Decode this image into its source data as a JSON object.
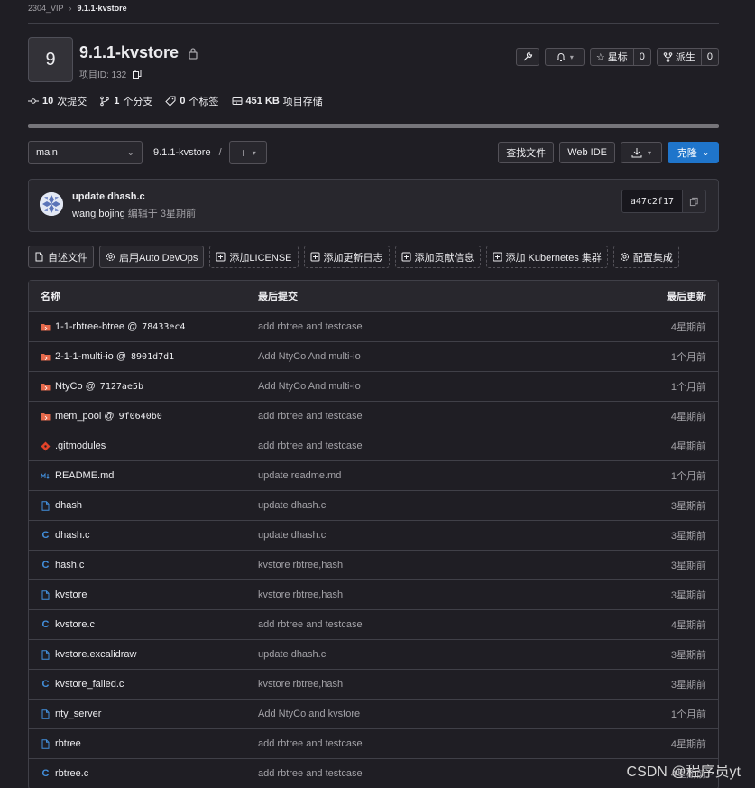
{
  "breadcrumb": {
    "parent": "2304_VIP",
    "current": "9.1.1-kvstore"
  },
  "project": {
    "avatar_letter": "9",
    "title": "9.1.1-kvstore",
    "id_label": "项目ID: 132"
  },
  "header_buttons": {
    "star_label": "星标",
    "star_count": "0",
    "fork_label": "派生",
    "fork_count": "0"
  },
  "stats": {
    "commits": "10",
    "commits_label": "次提交",
    "branches": "1",
    "branches_label": "个分支",
    "tags": "0",
    "tags_label": "个标签",
    "storage": "451 KB",
    "storage_label": "项目存储"
  },
  "toolbar": {
    "branch": "main",
    "path": "9.1.1-kvstore",
    "slash": "/",
    "find_file": "查找文件",
    "web_ide": "Web IDE",
    "clone": "克隆"
  },
  "last_commit": {
    "title": "update dhash.c",
    "author": "wang bojing",
    "edited": "编辑于 3星期前",
    "sha": "a47c2f17"
  },
  "actions": [
    {
      "label": "自述文件",
      "style": "solid",
      "icon": "file-icon"
    },
    {
      "label": "启用Auto DevOps",
      "style": "solid",
      "icon": "gear-icon"
    },
    {
      "label": "添加LICENSE",
      "style": "dashed",
      "icon": "plus-square-icon"
    },
    {
      "label": "添加更新日志",
      "style": "dashed",
      "icon": "plus-square-icon"
    },
    {
      "label": "添加贡献信息",
      "style": "dashed",
      "icon": "plus-square-icon"
    },
    {
      "label": "添加 Kubernetes 集群",
      "style": "dashed",
      "icon": "plus-square-icon"
    },
    {
      "label": "配置集成",
      "style": "dashed",
      "icon": "gear-icon"
    }
  ],
  "table": {
    "headers": {
      "name": "名称",
      "last_commit": "最后提交",
      "last_update": "最后更新"
    },
    "rows": [
      {
        "name": "1-1-rbtree-btree @",
        "ref": "78433ec4",
        "icon": "submodule-folder-icon",
        "msg": "add rbtree and testcase",
        "date": "4星期前"
      },
      {
        "name": "2-1-1-multi-io @",
        "ref": "8901d7d1",
        "icon": "submodule-folder-icon",
        "msg": "Add NtyCo And multi-io",
        "date": "1个月前"
      },
      {
        "name": "NtyCo @",
        "ref": "7127ae5b",
        "icon": "submodule-folder-icon",
        "msg": "Add NtyCo And multi-io",
        "date": "1个月前"
      },
      {
        "name": "mem_pool @",
        "ref": "9f0640b0",
        "icon": "submodule-folder-icon",
        "msg": "add rbtree and testcase",
        "date": "4星期前"
      },
      {
        "name": ".gitmodules",
        "ref": "",
        "icon": "git-icon",
        "msg": "add rbtree and testcase",
        "date": "4星期前"
      },
      {
        "name": "README.md",
        "ref": "",
        "icon": "markdown-icon",
        "msg": "update readme.md",
        "date": "1个月前"
      },
      {
        "name": "dhash",
        "ref": "",
        "icon": "file-icon",
        "msg": "update dhash.c",
        "date": "3星期前"
      },
      {
        "name": "dhash.c",
        "ref": "",
        "icon": "c-file-icon",
        "msg": "update dhash.c",
        "date": "3星期前"
      },
      {
        "name": "hash.c",
        "ref": "",
        "icon": "c-file-icon",
        "msg": "kvstore rbtree,hash",
        "date": "3星期前"
      },
      {
        "name": "kvstore",
        "ref": "",
        "icon": "file-icon",
        "msg": "kvstore rbtree,hash",
        "date": "3星期前"
      },
      {
        "name": "kvstore.c",
        "ref": "",
        "icon": "c-file-icon",
        "msg": "add rbtree and testcase",
        "date": "4星期前"
      },
      {
        "name": "kvstore.excalidraw",
        "ref": "",
        "icon": "file-icon",
        "msg": "update dhash.c",
        "date": "3星期前"
      },
      {
        "name": "kvstore_failed.c",
        "ref": "",
        "icon": "c-file-icon",
        "msg": "kvstore rbtree,hash",
        "date": "3星期前"
      },
      {
        "name": "nty_server",
        "ref": "",
        "icon": "file-icon",
        "msg": "Add NtyCo and kvstore",
        "date": "1个月前"
      },
      {
        "name": "rbtree",
        "ref": "",
        "icon": "file-icon",
        "msg": "add rbtree and testcase",
        "date": "4星期前"
      },
      {
        "name": "rbtree.c",
        "ref": "",
        "icon": "c-file-icon",
        "msg": "add rbtree and testcase",
        "date": "4星期前"
      }
    ]
  },
  "watermark": "CSDN @程序员yt",
  "colors": {
    "bg": "#1f1e24",
    "accent": "#1f75cb",
    "submodule": "#e66a4c",
    "file_icon": "#428fdc"
  }
}
